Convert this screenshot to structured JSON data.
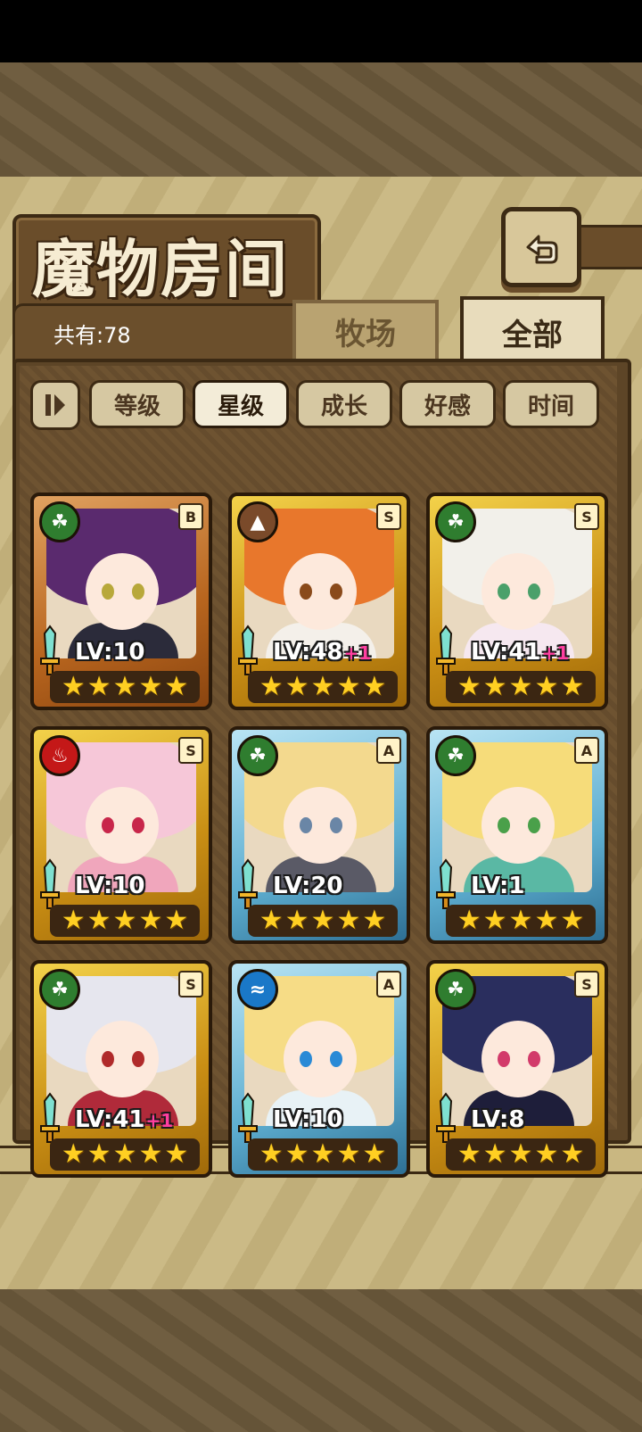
{
  "title": "魔物房间",
  "count_text": "共有:78",
  "tabs": [
    {
      "label": "牧场",
      "active": false
    },
    {
      "label": "全部",
      "active": true
    }
  ],
  "sort_buttons": [
    {
      "label": "等级",
      "active": false
    },
    {
      "label": "星级",
      "active": true
    },
    {
      "label": "成长",
      "active": false
    },
    {
      "label": "好感",
      "active": false
    },
    {
      "label": "时间",
      "active": false
    }
  ],
  "cards": [
    {
      "element": "grass",
      "rank": "B",
      "level": "LV:10",
      "bonus": "",
      "stars": 5,
      "frame": "bronze",
      "hair": "#5a2a6e",
      "eye": "#b8a83a",
      "outfit": "#2b2b3a"
    },
    {
      "element": "earth",
      "rank": "S",
      "level": "LV:48",
      "bonus": "+1",
      "stars": 5,
      "frame": "gold",
      "hair": "#e8772c",
      "eye": "#8a4a1a",
      "outfit": "#f4f0ea"
    },
    {
      "element": "grass",
      "rank": "S",
      "level": "LV:41",
      "bonus": "+1",
      "stars": 5,
      "frame": "gold",
      "hair": "#f2f0ea",
      "eye": "#4aa06a",
      "outfit": "#f6e8f0"
    },
    {
      "element": "fire",
      "rank": "S",
      "level": "LV:10",
      "bonus": "",
      "stars": 5,
      "frame": "gold",
      "hair": "#f6c7d8",
      "eye": "#c8264a",
      "outfit": "#f0a6bc"
    },
    {
      "element": "grass",
      "rank": "A",
      "level": "LV:20",
      "bonus": "",
      "stars": 5,
      "frame": "blue",
      "hair": "#f3d98e",
      "eye": "#6a86a6",
      "outfit": "#5a5a66"
    },
    {
      "element": "grass",
      "rank": "A",
      "level": "LV:1",
      "bonus": "",
      "stars": 5,
      "frame": "blue",
      "hair": "#f6dc7a",
      "eye": "#4aa04a",
      "outfit": "#5ab8a4"
    },
    {
      "element": "grass",
      "rank": "S",
      "level": "LV:41",
      "bonus": "+1",
      "stars": 5,
      "frame": "gold",
      "hair": "#e6e6ee",
      "eye": "#b02a2a",
      "outfit": "#b02a3a"
    },
    {
      "element": "water",
      "rank": "A",
      "level": "LV:10",
      "bonus": "",
      "stars": 5,
      "frame": "blue",
      "hair": "#f6dc86",
      "eye": "#2a8ad6",
      "outfit": "#e8f2f6"
    },
    {
      "element": "grass",
      "rank": "S",
      "level": "LV:8",
      "bonus": "",
      "stars": 5,
      "frame": "gold",
      "hair": "#2a2e5e",
      "eye": "#d23a6a",
      "outfit": "#1e1e3a"
    }
  ],
  "element_icons": {
    "grass": "leaf-icon",
    "earth": "mountain-icon",
    "fire": "flame-icon",
    "water": "wave-icon"
  }
}
